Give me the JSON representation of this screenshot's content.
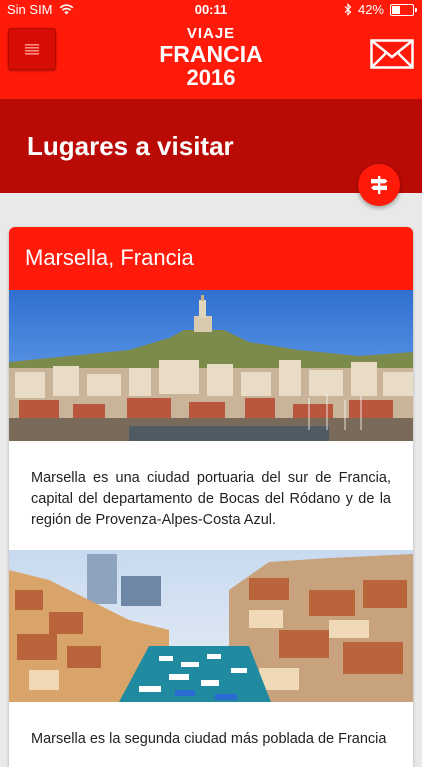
{
  "status_bar": {
    "carrier": "Sin SIM",
    "time": "00:11",
    "battery": "42%",
    "battery_level": 0.42
  },
  "header": {
    "brand_line1": "VIAJE",
    "brand_line2": "FRANCIA",
    "brand_line3": "2016",
    "menu_icon": "hamburger-menu-icon",
    "mail_icon": "envelope-icon"
  },
  "page": {
    "title": "Lugares a visitar",
    "fab_icon": "signpost-icon"
  },
  "card": {
    "title": "Marsella, Francia",
    "paragraph1": "Marsella es una ciudad portuaria del sur de Francia, capital del departamento de Bocas del Ródano y de la región de Provenza-Alpes-Costa Azul.",
    "paragraph2": "Marsella es la segunda ciudad más poblada de Francia"
  },
  "colors": {
    "primary_red": "#ff1a0a",
    "dark_red": "#ba0a06"
  }
}
